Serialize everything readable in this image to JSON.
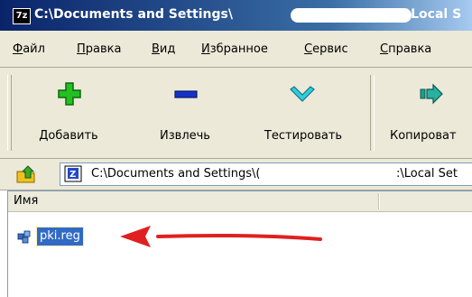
{
  "window": {
    "app_icon_label": "7z",
    "title_prefix": "C:\\Documents and Settings\\",
    "title_suffix": "\\Local S"
  },
  "menu": {
    "items": [
      {
        "first": "Ф",
        "rest": "айл"
      },
      {
        "first": "П",
        "rest": "равка"
      },
      {
        "first": "В",
        "rest": "ид"
      },
      {
        "first": "И",
        "rest": "збранное"
      },
      {
        "first": "С",
        "rest": "ервис"
      },
      {
        "first": "С",
        "rest": "правка"
      }
    ]
  },
  "toolbar": {
    "add_label": "Добавить",
    "extract_label": "Извлечь",
    "test_label": "Тестировать",
    "copy_label": "Копироват"
  },
  "address": {
    "path_prefix": "C:\\Documents and Settings\\(",
    "path_suffix": ":\\Local Set"
  },
  "filelist": {
    "columns": [
      "Имя"
    ],
    "items": [
      {
        "name": "pki.reg",
        "selected": true
      }
    ]
  },
  "colors": {
    "annotation_arrow": "#e02020",
    "selection": "#316ac5",
    "add_icon": "#22c022",
    "extract_icon": "#1432c8",
    "test_icon": "#33ccdd"
  }
}
